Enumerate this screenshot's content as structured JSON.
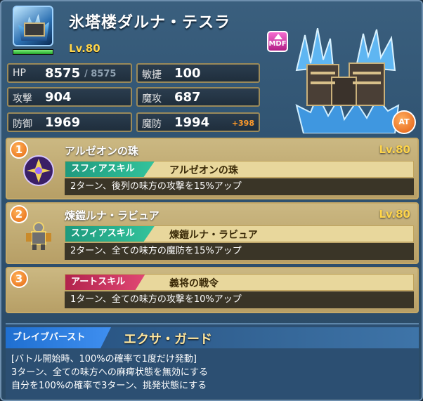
{
  "unit": {
    "name": "氷塔楼ダルナ・テスラ",
    "level": "Lv.80",
    "hp_fill": 1.0,
    "badges": {
      "mdf": "MDF",
      "at": "AT"
    }
  },
  "stats": {
    "hp": {
      "label": "HP",
      "value": "8575",
      "max": "/ 8575"
    },
    "attack": {
      "label": "攻撃",
      "value": "904"
    },
    "defense": {
      "label": "防御",
      "value": "1969"
    },
    "agility": {
      "label": "敏捷",
      "value": "100"
    },
    "magic_attack": {
      "label": "魔攻",
      "value": "687"
    },
    "magic_defense": {
      "label": "魔防",
      "value": "1994",
      "bonus": "+398"
    }
  },
  "skills": [
    {
      "num": "1",
      "name": "アルゼオンの珠",
      "level": "Lv.80",
      "type": "スフィアスキル",
      "skill_name": "アルゼオンの珠",
      "desc": "2ターン、後列の味方の攻撃を15%アップ"
    },
    {
      "num": "2",
      "name": "煉鎧ルナ・ラビュア",
      "level": "Lv.80",
      "type": "スフィアスキル",
      "skill_name": "煉鎧ルナ・ラビュア",
      "desc": "2ターン、全ての味方の魔防を15%アップ"
    },
    {
      "num": "3",
      "type": "アートスキル",
      "skill_name": "義将の戦令",
      "desc": "1ターン、全ての味方の攻撃を10%アップ"
    }
  ],
  "brave_burst": {
    "label": "ブレイブバースト",
    "name": "エクサ・ガード",
    "lines": [
      "[バトル開始時、100%の確率で1度だけ発動]",
      "3ターン、全ての味方への麻痺状態を無効にする",
      "自分を100%の確率で3ターン、挑発状態にする"
    ]
  }
}
